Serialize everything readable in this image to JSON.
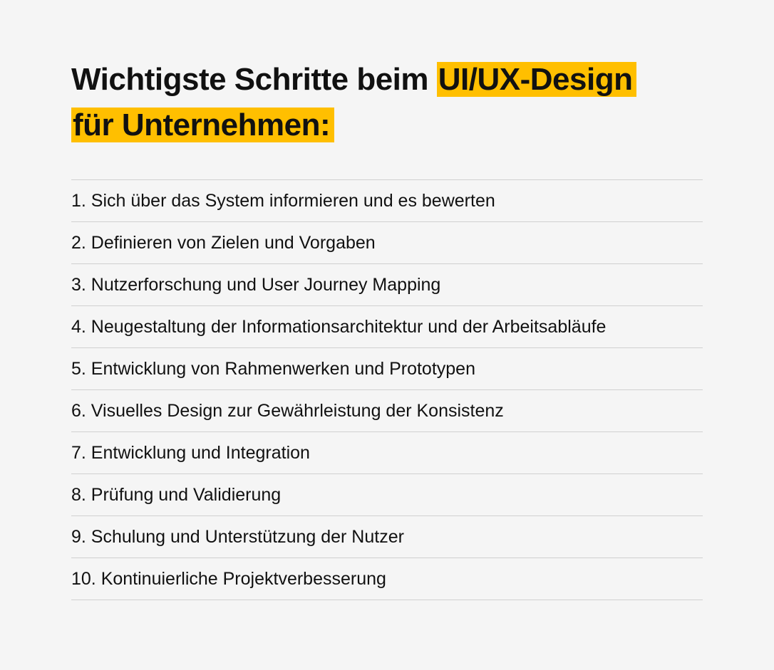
{
  "title": {
    "plain_prefix": "Wichtigste Schritte beim ",
    "highlight_1": "UI/UX-Design",
    "highlight_2": "für Unternehmen:"
  },
  "items": [
    "1. Sich über das System informieren und es bewerten",
    "2. Definieren von Zielen und Vorgaben",
    "3. Nutzerforschung und User Journey Mapping",
    "4. Neugestaltung der Informationsarchitektur und der Arbeitsabläufe",
    "5. Entwicklung von Rahmenwerken und Prototypen",
    "6. Visuelles Design zur Gewährleistung der Konsistenz",
    "7. Entwicklung und Integration",
    "8. Prüfung und Validierung",
    "9. Schulung und Unterstützung der Nutzer",
    "10. Kontinuierliche Projektverbesserung"
  ]
}
